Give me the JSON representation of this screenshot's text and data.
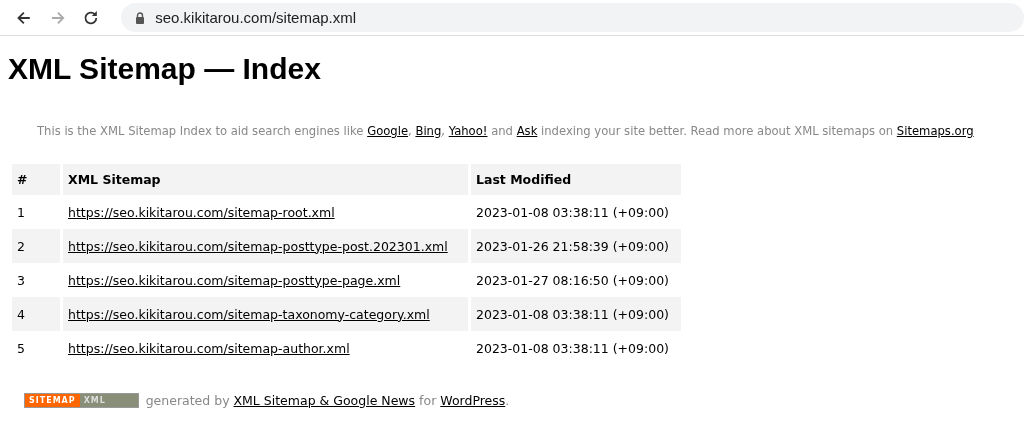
{
  "browser": {
    "url": "seo.kikitarou.com/sitemap.xml"
  },
  "title": "XML Sitemap — Index",
  "intro": [
    {
      "kind": "text",
      "text": "This is the XML Sitemap Index to aid search engines like "
    },
    {
      "kind": "link",
      "text": "Google"
    },
    {
      "kind": "text",
      "text": ", "
    },
    {
      "kind": "link",
      "text": "Bing"
    },
    {
      "kind": "text",
      "text": ", "
    },
    {
      "kind": "link",
      "text": "Yahoo!"
    },
    {
      "kind": "text",
      "text": " and "
    },
    {
      "kind": "link",
      "text": "Ask"
    },
    {
      "kind": "text",
      "text": " indexing your site better. Read more about XML sitemaps on "
    },
    {
      "kind": "link",
      "text": "Sitemaps.org"
    }
  ],
  "table": {
    "columns": [
      "#",
      "XML Sitemap",
      "Last Modified"
    ],
    "rows": [
      {
        "number": "1",
        "url": "https://seo.kikitarou.com/sitemap-root.xml",
        "modified": "2023-01-08 03:38:11 (+09:00)"
      },
      {
        "number": "2",
        "url": "https://seo.kikitarou.com/sitemap-posttype-post.202301.xml",
        "modified": "2023-01-26 21:58:39 (+09:00)"
      },
      {
        "number": "3",
        "url": "https://seo.kikitarou.com/sitemap-posttype-page.xml",
        "modified": "2023-01-27 08:16:50 (+09:00)"
      },
      {
        "number": "4",
        "url": "https://seo.kikitarou.com/sitemap-taxonomy-category.xml",
        "modified": "2023-01-08 03:38:11 (+09:00)"
      },
      {
        "number": "5",
        "url": "https://seo.kikitarou.com/sitemap-author.xml",
        "modified": "2023-01-08 03:38:11 (+09:00)"
      }
    ]
  },
  "footer": {
    "badge": {
      "left": "SITEMAP",
      "right": "XML"
    },
    "parts": [
      {
        "kind": "text",
        "text": " generated by "
      },
      {
        "kind": "link",
        "text": "XML Sitemap & Google News"
      },
      {
        "kind": "text",
        "text": " for "
      },
      {
        "kind": "link",
        "text": "WordPress"
      },
      {
        "kind": "text",
        "text": "."
      }
    ]
  }
}
